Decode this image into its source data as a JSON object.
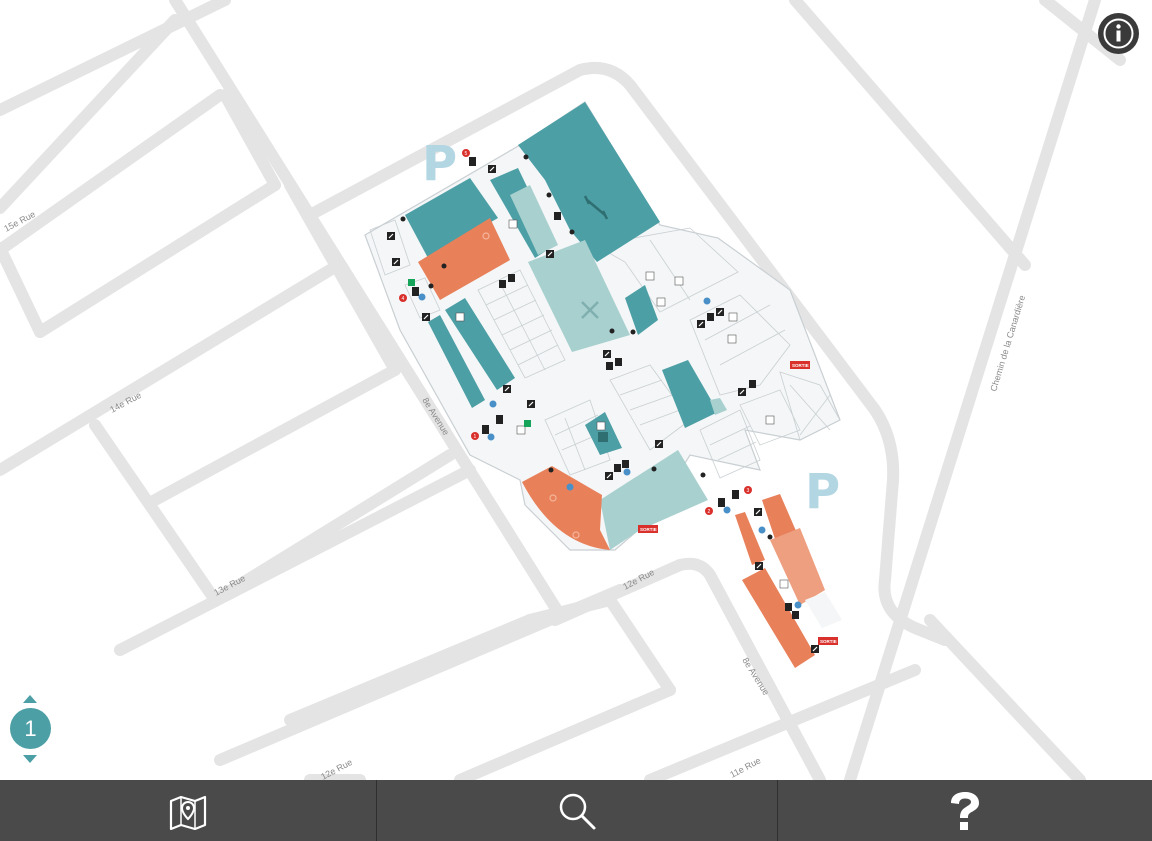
{
  "map": {
    "streets": [
      "15e Rue",
      "14e Rue",
      "13e Rue",
      "12e Rue",
      "12e Rue",
      "11e Rue",
      "8e Avenue",
      "8e Avenue",
      "Chemin de la Canardière"
    ],
    "parking_label": "P",
    "exit_label": "SORTIE",
    "entrance_numbers": [
      "1",
      "2",
      "3",
      "4",
      "5"
    ]
  },
  "floor": {
    "current": "1"
  },
  "toolbar": {
    "items": [
      "map-icon",
      "search-icon",
      "help-icon"
    ]
  },
  "colors": {
    "teal": "#4c9fa5",
    "teal_dark": "#3d8f94",
    "teal_light": "#a8d0cf",
    "orange": "#e8805a",
    "salmon": "#ee9f80",
    "toolbar": "#4a4a4a",
    "street": "#e6e6e6"
  }
}
